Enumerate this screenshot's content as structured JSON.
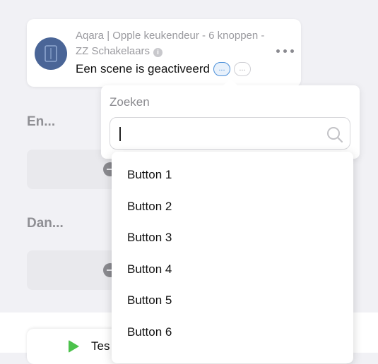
{
  "trigger_card": {
    "title": "Aqara | Opple keukendeur - 6 knoppen - ZZ Schakelaars",
    "trigger_text": "Een scene is geactiveerd",
    "pill_active": "...",
    "pill_idle": "...",
    "info_glyph": "i",
    "icons": [
      "device-icon",
      "info-icon",
      "more-icon"
    ]
  },
  "sections": {
    "and_label": "En...",
    "then_label": "Dan..."
  },
  "search": {
    "label": "Zoeken",
    "value": "",
    "icon": "search-icon"
  },
  "dropdown": {
    "options": [
      "Button 1",
      "Button 2",
      "Button 3",
      "Button 4",
      "Button 5",
      "Button 6"
    ]
  },
  "footer": {
    "test_label": "Tes",
    "icon": "play-icon",
    "play_color": "#4cc24c"
  },
  "colors": {
    "accent": "#4a8fd9",
    "avatar": "#4a6597",
    "background": "#f1f1f5"
  }
}
